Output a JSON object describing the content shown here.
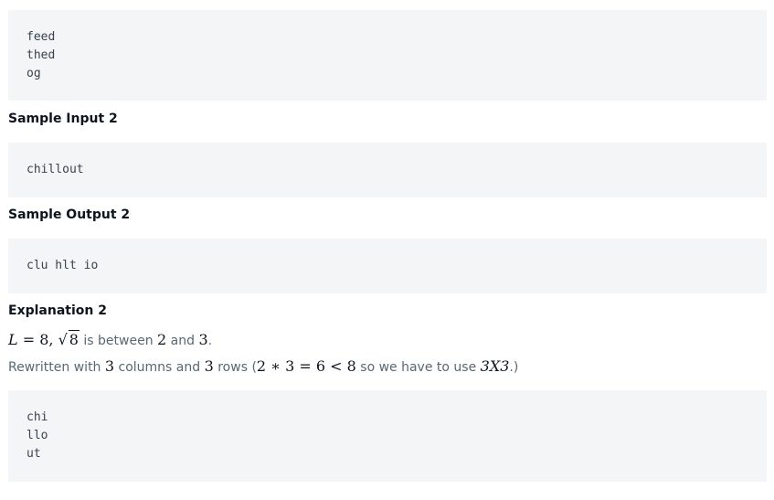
{
  "block1": {
    "lines": [
      "feed",
      "thed",
      "og"
    ]
  },
  "sample_input_2": {
    "heading": "Sample Input 2",
    "lines": [
      "chillout"
    ]
  },
  "sample_output_2": {
    "heading": "Sample Output 2",
    "lines": [
      "clu hlt io"
    ]
  },
  "explanation_2": {
    "heading": "Explanation 2",
    "line1": {
      "L": "L",
      "eq": " = 8, ",
      "sqrt_sym": "√",
      "radicand": "8",
      "text1": " is between ",
      "a": "2",
      "and": " and ",
      "b": "3",
      "end": "."
    },
    "line2": {
      "t1": "Rewritten with ",
      "c": "3",
      "t2": " columns and ",
      "r": "3",
      "t3": " rows (",
      "expr": "2 ∗ 3 = 6 < 8",
      "t4": " so we have to use ",
      "grid": "3X3",
      "t5": ".)"
    },
    "grid_lines": [
      "chi",
      "llo",
      "ut"
    ]
  }
}
